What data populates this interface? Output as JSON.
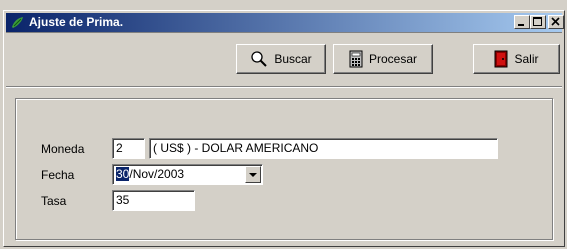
{
  "window": {
    "title": "Ajuste de Prima."
  },
  "background_text": "...",
  "toolbar": {
    "buscar_label": "Buscar",
    "procesar_label": "Procesar",
    "salir_label": "Salir"
  },
  "form": {
    "moneda_label": "Moneda",
    "moneda_code": "2",
    "moneda_name": "( US$ ) - DOLAR AMERICANO",
    "fecha_label": "Fecha",
    "fecha_day": "30",
    "fecha_rest": "/Nov/2003",
    "tasa_label": "Tasa",
    "tasa_value": "35"
  },
  "colors": {
    "titlebar_start": "#0a246a",
    "titlebar_end": "#a6caf0",
    "window_bg": "#d4d0c8",
    "selection": "#0a246a"
  },
  "icons": [
    "app-icon",
    "search-icon",
    "calculator-icon",
    "exit-door-icon"
  ]
}
